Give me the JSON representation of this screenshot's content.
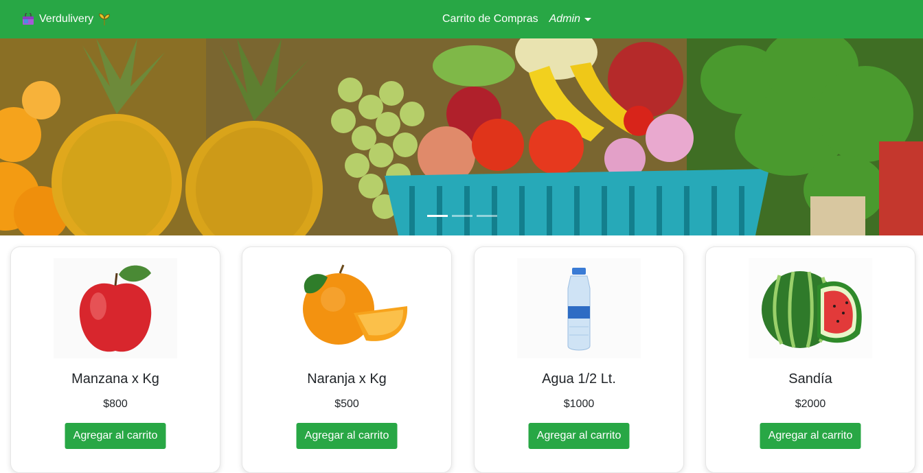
{
  "navbar": {
    "brand": "Verdulivery",
    "cart_link": "Carrito de Compras",
    "admin_label": "Admin",
    "color": "#28a745"
  },
  "carousel": {
    "slide_count": 3,
    "active_index": 0
  },
  "products": [
    {
      "name": "Manzana x Kg",
      "price": "$800",
      "button": "Agregar al carrito",
      "icon": "apple-image"
    },
    {
      "name": "Naranja x Kg",
      "price": "$500",
      "button": "Agregar al carrito",
      "icon": "orange-image"
    },
    {
      "name": "Agua 1/2 Lt.",
      "price": "$1000",
      "button": "Agregar al carrito",
      "icon": "water-bottle-image"
    },
    {
      "name": "Sandía",
      "price": "$2000",
      "button": "Agregar al carrito",
      "icon": "watermelon-image"
    }
  ]
}
